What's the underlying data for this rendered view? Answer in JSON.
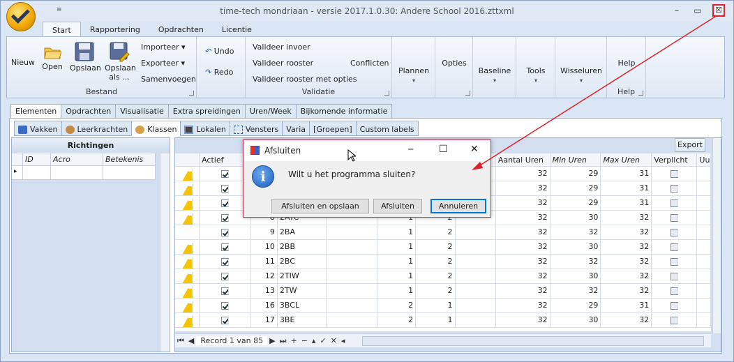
{
  "window": {
    "title": "time-tech mondriaan - versie 2017.1.0.30: Andere School 2016.zttxml",
    "minimize": "–",
    "maximize": "▭",
    "close": "☒",
    "qat": "≡"
  },
  "ribbon": {
    "tabs": [
      "Start",
      "Rapportering",
      "Opdrachten",
      "Licentie"
    ],
    "bestand": {
      "label": "Bestand",
      "nieuw": "Nieuw",
      "open": "Open",
      "opslaan": "Opslaan",
      "opslaan_als_1": "Opslaan",
      "opslaan_als_2": "als ...",
      "importeer": "Importeer ▾",
      "exporteer": "Exporteer ▾",
      "samenvoegen": "Samenvoegen"
    },
    "edit": {
      "undo": "Undo",
      "redo": "Redo"
    },
    "validatie": {
      "label": "Validatie",
      "invoer": "Valideer invoer",
      "rooster": "Valideer rooster",
      "rooster_opties": "Valideer rooster met opties",
      "conflicten": "Conflicten"
    },
    "plannen": "Plannen",
    "opties": "Opties",
    "baseline": "Baseline",
    "tools": "Tools",
    "wisseluren": "Wisseluren",
    "help": {
      "label": "Help",
      "btn": "Help"
    }
  },
  "level1_tabs": [
    "Elementen",
    "Opdrachten",
    "Visualisatie",
    "Extra spreidingen",
    "Uren/Week",
    "Bijkomende informatie"
  ],
  "level2_tabs": [
    "Vakken",
    "Leerkrachten",
    "Klassen",
    "Lokalen",
    "Vensters",
    "Varia",
    "[Groepen]",
    "Custom labels"
  ],
  "left_panel": {
    "title": "Richtingen",
    "columns": [
      "ID",
      "Acro",
      "Betekenis"
    ],
    "row_marker": "▸"
  },
  "right_panel": {
    "export": "Export",
    "columns": [
      "",
      "Actief",
      "",
      "",
      "",
      "",
      "",
      "",
      "Aantal Uren",
      "Min Uren",
      "Max Uren",
      "Verplicht",
      "Uu"
    ],
    "rows": [
      {
        "warn": true,
        "actief": true,
        "nr": "",
        "code": "",
        "a": "",
        "b": "",
        "uren": "32",
        "min": "29",
        "max": "31",
        "verplicht": false
      },
      {
        "warn": true,
        "actief": true,
        "nr": "",
        "code": "",
        "a": "",
        "b": "",
        "uren": "32",
        "min": "29",
        "max": "31",
        "verplicht": false
      },
      {
        "warn": true,
        "actief": true,
        "nr": "",
        "code": "",
        "a": "",
        "b": "",
        "uren": "32",
        "min": "29",
        "max": "31",
        "verplicht": false
      },
      {
        "warn": true,
        "actief": true,
        "nr": "8",
        "code": "2ATC",
        "a": "1",
        "b": "2",
        "uren": "32",
        "min": "30",
        "max": "32",
        "verplicht": false
      },
      {
        "warn": false,
        "actief": true,
        "nr": "9",
        "code": "2BA",
        "a": "1",
        "b": "2",
        "uren": "32",
        "min": "32",
        "max": "32",
        "verplicht": false
      },
      {
        "warn": true,
        "actief": true,
        "nr": "10",
        "code": "2BB",
        "a": "1",
        "b": "2",
        "uren": "32",
        "min": "30",
        "max": "32",
        "verplicht": false
      },
      {
        "warn": true,
        "actief": true,
        "nr": "11",
        "code": "2BC",
        "a": "1",
        "b": "2",
        "uren": "32",
        "min": "32",
        "max": "32",
        "verplicht": false
      },
      {
        "warn": true,
        "actief": true,
        "nr": "12",
        "code": "2TIW",
        "a": "1",
        "b": "2",
        "uren": "32",
        "min": "30",
        "max": "32",
        "verplicht": false
      },
      {
        "warn": true,
        "actief": true,
        "nr": "13",
        "code": "2TW",
        "a": "1",
        "b": "2",
        "uren": "32",
        "min": "32",
        "max": "32",
        "verplicht": false
      },
      {
        "warn": true,
        "actief": true,
        "nr": "16",
        "code": "3BCL",
        "a": "2",
        "b": "1",
        "uren": "32",
        "min": "29",
        "max": "31",
        "verplicht": false
      },
      {
        "warn": true,
        "actief": true,
        "nr": "17",
        "code": "3BE",
        "a": "2",
        "b": "1",
        "uren": "32",
        "min": "30",
        "max": "32",
        "verplicht": false
      }
    ],
    "record": "Record 1 van 85"
  },
  "dialog": {
    "title": "Afsluiten",
    "message": "Wilt u het programma sluiten?",
    "btn_save": "Afsluiten en opslaan",
    "btn_close": "Afsluiten",
    "btn_cancel": "Annuleren",
    "min": "─",
    "max": "☐",
    "x": "✕"
  },
  "colors": {
    "arrow": "#e0202a",
    "ribbon_bg": "#dfe8f4",
    "dialog_border": "#c0365a"
  }
}
